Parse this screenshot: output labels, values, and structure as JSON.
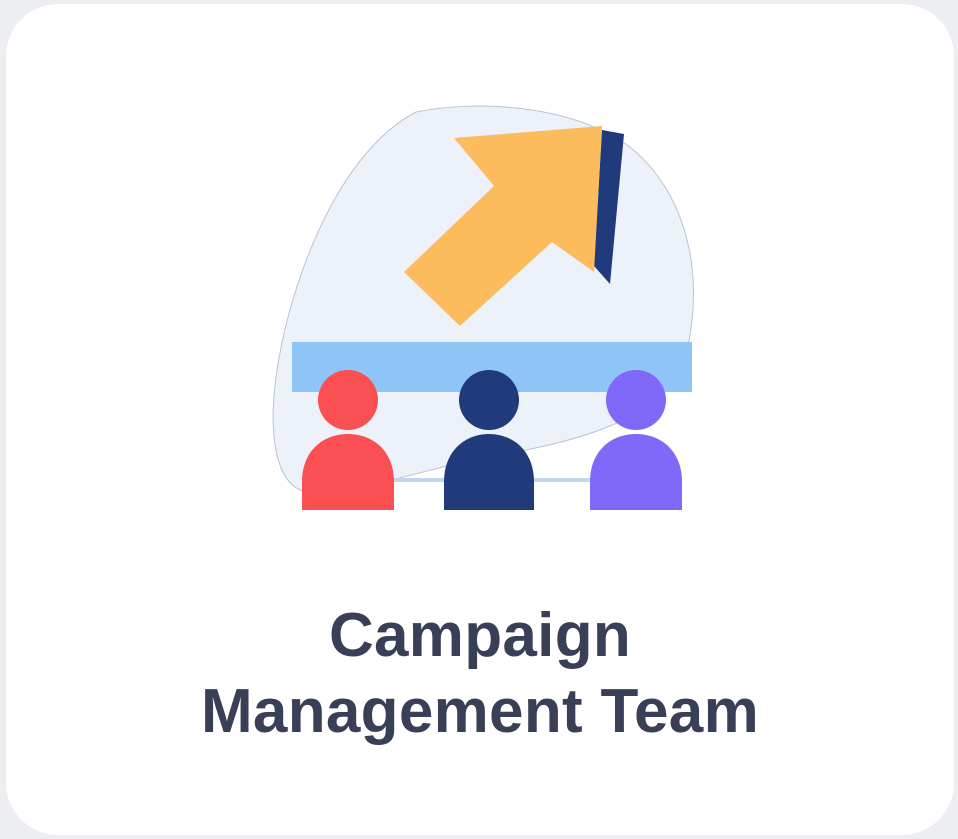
{
  "card": {
    "title_line1": "Campaign",
    "title_line2": "Management Team"
  },
  "icons": {
    "illustration": "team-growth-arrow-icon"
  },
  "colors": {
    "title_text": "#3a3f58",
    "blob": "#edf2fa",
    "arrow": "#fcbb5c",
    "arrow_shadow": "#213a7b",
    "board": "#8ec5f6",
    "person_left": "#fa4f53",
    "person_center": "#213a7b",
    "person_right": "#8069f8"
  }
}
